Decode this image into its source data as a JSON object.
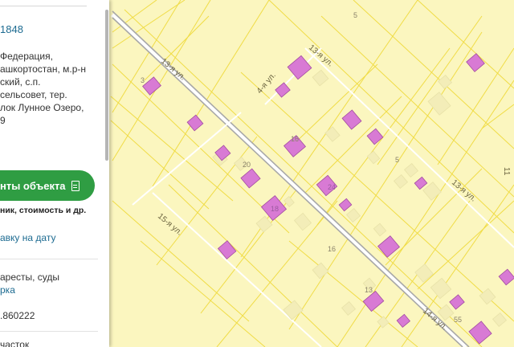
{
  "panel": {
    "cadastral_number_suffix": "1848",
    "address_lines": [
      "Федерация,",
      "ашкортостан, м.р-н",
      "ский, с.п.",
      "сельсовет, тер.",
      "лок Лунное Озеро,",
      "9"
    ],
    "documents_button_label": "нты объекта",
    "documents_button_icon": "document-icon",
    "documents_subtitle": "ник, стоимость и др.",
    "date_request_link": "авку на дату",
    "arrests_text": "аресты, суды",
    "check_link": "рка",
    "phone_text": ".860222",
    "bottom_text": "часток",
    "accent_color": "#2f9d43",
    "link_color": "#1d6b91"
  },
  "map": {
    "background_color": "#fbf6bf",
    "parcel_line_color": "#f0dc46",
    "building_color": "#d87ad4",
    "street_labels": [
      "13-я ул.",
      "4-я ул.",
      "13-я ул.",
      "13-я ул.",
      "15-я ул.",
      "14-я ул."
    ],
    "parcel_numbers": [
      "5",
      "3",
      "20",
      "24",
      "16",
      "18",
      "5",
      "16",
      "13",
      "55",
      "11"
    ]
  }
}
